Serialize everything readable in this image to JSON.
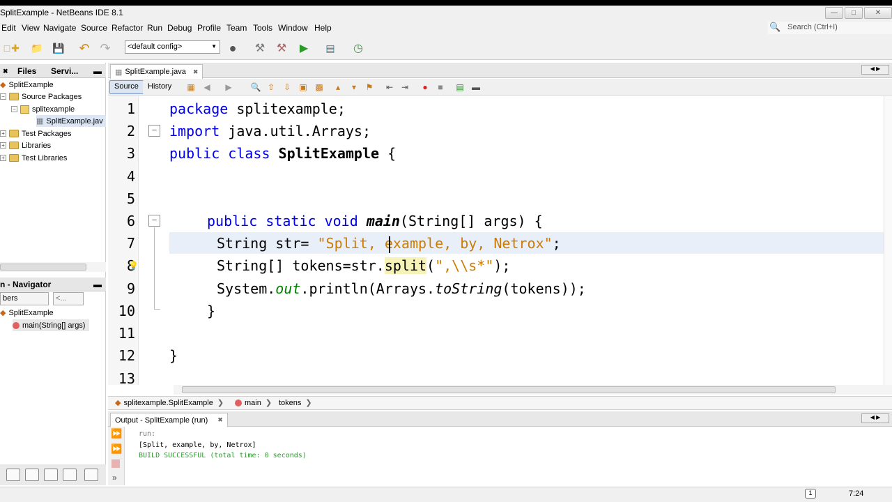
{
  "window": {
    "title": "SplitExample - NetBeans IDE 8.1"
  },
  "menu": [
    "Edit",
    "View",
    "Navigate",
    "Source",
    "Refactor",
    "Run",
    "Debug",
    "Profile",
    "Team",
    "Tools",
    "Window",
    "Help"
  ],
  "search": {
    "placeholder": "Search (Ctrl+I)"
  },
  "toolbar": {
    "config": "<default config>"
  },
  "projects_panel": {
    "tabs": [
      "Files",
      "Servi..."
    ],
    "tree": [
      {
        "label": "SplitExample",
        "icon": "project-icon"
      },
      {
        "label": "Source Packages",
        "icon": "folder-icon"
      },
      {
        "label": "splitexample",
        "icon": "package-icon"
      },
      {
        "label": "SplitExample.jav",
        "icon": "java-file-icon"
      },
      {
        "label": "Test Packages",
        "icon": "folder-icon"
      },
      {
        "label": "Libraries",
        "icon": "folder-icon"
      },
      {
        "label": "Test Libraries",
        "icon": "folder-icon"
      }
    ]
  },
  "navigator": {
    "title": "n - Navigator",
    "filter": "bers",
    "combo2": "<...",
    "items": [
      "SplitExample",
      "main(String[] args)"
    ]
  },
  "editor": {
    "tab": "SplitExample.java",
    "source_button": "Source",
    "history_button": "History",
    "line_numbers": [
      "1",
      "2",
      "3",
      "4",
      "5",
      "6",
      "7",
      "8",
      "9",
      "10",
      "11",
      "12",
      "13"
    ],
    "code": {
      "l1_kw": "package",
      "l1_rest": " splitexample;",
      "l2_kw": "import",
      "l2_rest": " java.util.Arrays;",
      "l3_kw1": "public",
      "l3_kw2": " class ",
      "l3_name": "SplitExample",
      "l3_rest": " {",
      "l6_kw": "public static void ",
      "l6_name": "main",
      "l6_rest": "(String[] args) {",
      "l7_a": "String str= ",
      "l7_str": "\"Split, example, by, Netrox\"",
      "l7_end": ";",
      "l8_a": "String[] tokens=str.",
      "l8_split": "split",
      "l8_b": "(",
      "l8_str": "\",\\\\s*\"",
      "l8_end": ");",
      "l9_a": "System.",
      "l9_out": "out",
      "l9_b": ".println(Arrays.",
      "l9_ts": "toString",
      "l9_end": "(tokens));",
      "l10": "}",
      "l12": "}"
    }
  },
  "breadcrumbs": [
    "splitexample.SplitExample",
    "main",
    "tokens"
  ],
  "output": {
    "tab": "Output - SplitExample (run)",
    "lines": [
      "run:",
      "[Split, example, by, Netrox]",
      "BUILD SUCCESSFUL (total time: 0 seconds)"
    ]
  },
  "status": {
    "time": "7:24",
    "notifications": "1"
  }
}
